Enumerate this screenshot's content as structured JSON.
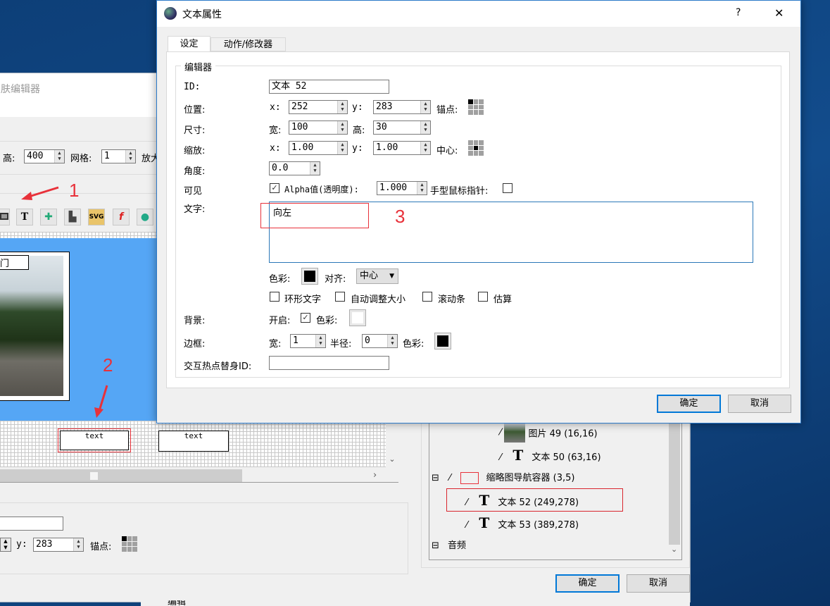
{
  "skin_editor": {
    "title": "皮肤编辑器",
    "height_label": "高:",
    "height_value": "400",
    "grid_label": "网格:",
    "grid_value": "1",
    "zoom_label": "放大",
    "toolbar_icons": [
      "rectangle-icon",
      "text-icon",
      "hotspot-icon",
      "container-icon",
      "svg-icon",
      "flash-icon",
      "globe-icon"
    ],
    "toolbar_text_glyph": "T",
    "image_label": "门",
    "textbox_1": "text",
    "textbox_2": "text",
    "lower": {
      "y_label": "y:",
      "y_value": "283",
      "anchor_label": "锚点:"
    },
    "tree": {
      "items": [
        {
          "label": "图片 49 (16,16)"
        },
        {
          "label": "文本 50 (63,16)"
        },
        {
          "label": "缩略图导航容器 (3,5)",
          "expander": "⊟"
        },
        {
          "label": "文本 52 (249,278)",
          "selected": true
        },
        {
          "label": "文本 53 (389,278)"
        },
        {
          "label": "音频",
          "expander": "⊟"
        }
      ]
    },
    "ok_label": "确定",
    "cancel_label": "取消",
    "bottom_partial": "编辑"
  },
  "annotations": {
    "one": "1",
    "two": "2",
    "three": "3",
    "color": "#e8313a"
  },
  "dialog": {
    "title": "文本属性",
    "help": "?",
    "close": "✕",
    "tabs": [
      {
        "label": "设定",
        "active": true
      },
      {
        "label": "动作/修改器"
      }
    ],
    "group_label": "编辑器",
    "id_label": "ID:",
    "id_value": "文本 52",
    "position_label": "位置:",
    "x_label": "x:",
    "y_label": "y:",
    "pos_x": "252",
    "pos_y": "283",
    "anchor_label": "锚点:",
    "size_label": "尺寸:",
    "width_label": "宽:",
    "height_label": "高:",
    "size_w": "100",
    "size_h": "30",
    "scale_label": "缩放:",
    "scale_x": "1.00",
    "scale_y": "1.00",
    "center_label": "中心:",
    "angle_label": "角度:",
    "angle_value": "0.0",
    "visible_label": "可见",
    "visible_checked": true,
    "alpha_label": "Alpha值(透明度):",
    "alpha_value": "1.000",
    "hand_cursor_label": "手型鼠标指针:",
    "hand_cursor_checked": false,
    "text_label": "文字:",
    "text_value": "向左",
    "color_label": "色彩:",
    "text_color": "#000000",
    "align_label": "对齐:",
    "align_value": "中心",
    "options": [
      {
        "label": "环形文字",
        "checked": false
      },
      {
        "label": "自动调整大小",
        "checked": false
      },
      {
        "label": "滚动条",
        "checked": false
      },
      {
        "label": "估算",
        "checked": false
      }
    ],
    "background_label": "背景:",
    "bg_enable_label": "开启:",
    "bg_enabled": true,
    "bg_color": "#ffffff",
    "border_label": "边框:",
    "border_width": "1",
    "radius_label": "半径:",
    "border_radius": "0",
    "border_color": "#000000",
    "hotspot_proxy_label": "交互热点替身ID:",
    "hotspot_proxy_value": "",
    "ok_label": "确定",
    "cancel_label": "取消"
  }
}
